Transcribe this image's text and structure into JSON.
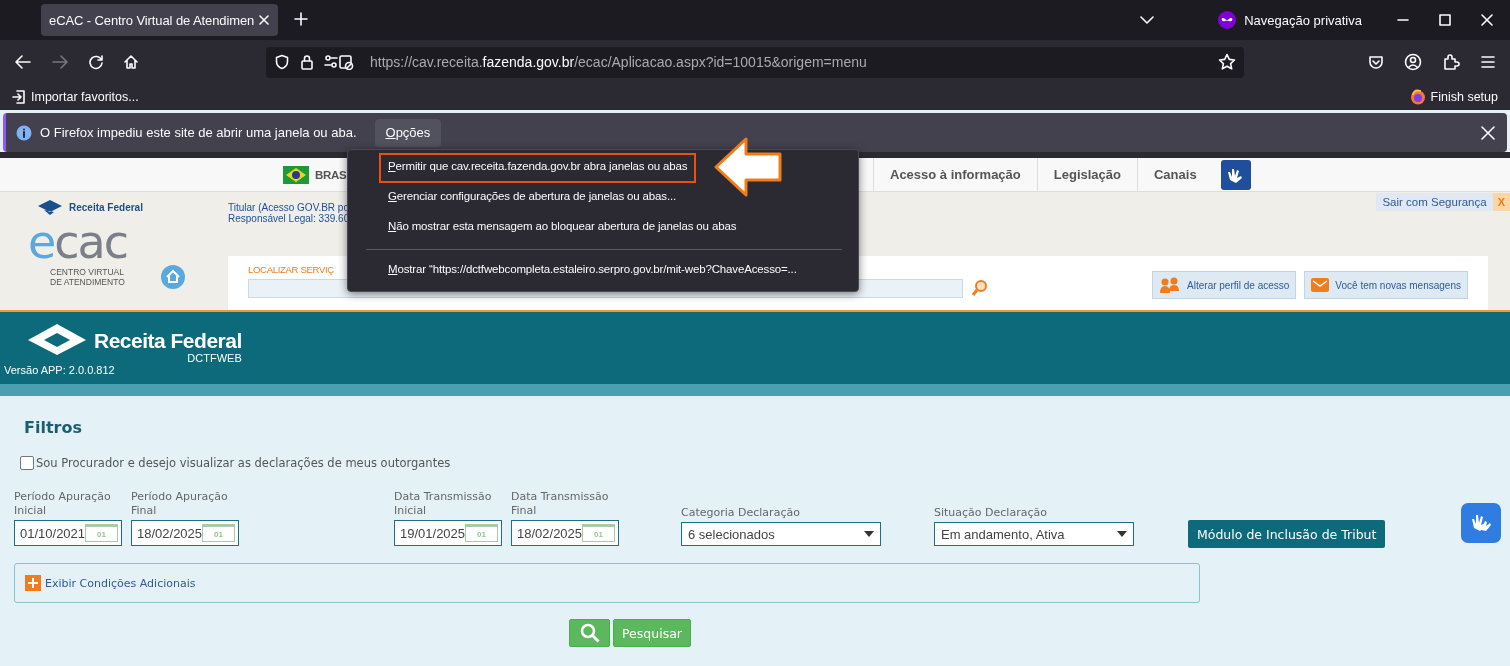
{
  "browser": {
    "tab_title": "eCAC - Centro Virtual de Atendimen",
    "private_label": "Navegação privativa",
    "url_prefix": "https://cav.receita.",
    "url_domain": "fazenda.gov.br",
    "url_suffix": "/ecac/Aplicacao.aspx?id=10015&origem=menu",
    "bookmark": "Importar favoritos...",
    "finish_setup": "Finish setup"
  },
  "notification": {
    "message": "O Firefox impediu este site de abrir uma janela ou aba.",
    "options_button": "Opções"
  },
  "popup_menu": {
    "items": [
      {
        "kind": "item",
        "label": "Permitir que cav.receita.fazenda.gov.br abra janelas ou abas",
        "highlighted": true
      },
      {
        "kind": "item",
        "label": "Gerenciar configurações de abertura de janelas ou abas...",
        "highlighted": false
      },
      {
        "kind": "item",
        "label": "Não mostrar esta mensagem ao bloquear abertura de janelas ou abas",
        "highlighted": false
      },
      {
        "kind": "separator"
      },
      {
        "kind": "item",
        "label": "Mostrar “https://dctfwebcompleta.estaleiro.serpro.gov.br/mit-web?ChaveAcesso=...",
        "highlighted": false
      }
    ]
  },
  "gov_bar": {
    "country": "BRAS",
    "links": [
      "Acesso à informação",
      "Legislação",
      "Canais"
    ]
  },
  "ecac_header": {
    "brand": "Receita Federal",
    "logo_word": "ecac",
    "logo_subtitle": "CENTRO VIRTUAL DE ATENDIMENTO",
    "user_lines": [
      "Titular (Acesso GOV.BR po",
      "Responsável Legal: 339.60"
    ],
    "logout": "Sair com Segurança",
    "logout_close": "X",
    "search_label": "LOCALIZAR SERVIÇ",
    "buttons": [
      "Alterar perfil de acesso",
      "Você tem novas mensagens"
    ]
  },
  "app_header": {
    "brand": "Receita Federal",
    "product": "DCTFWEB",
    "version": "Versão APP: 2.0.0.812"
  },
  "filters": {
    "title": "Filtros",
    "procurador": {
      "label": "Sou Procurador e desejo visualizar as declarações de meus outorgantes",
      "checked": false
    },
    "date_fields": [
      {
        "label": "Período Apuração Inicial",
        "value": "01/10/2021",
        "icon_text": "01"
      },
      {
        "label": "Período Apuração Final",
        "value": "18/02/2025",
        "icon_text": "01"
      },
      {
        "label": "Data Transmissão Inicial",
        "value": "19/01/2025",
        "icon_text": "01"
      },
      {
        "label": "Data Transmissão Final",
        "value": "18/02/2025",
        "icon_text": "01"
      }
    ],
    "selects": [
      {
        "label": "Categoria Declaração",
        "value": "6 selecionados"
      },
      {
        "label": "Situação Declaração",
        "value": "Em andamento, Ativa"
      }
    ],
    "module_button": "Módulo de Inclusão de Tribut",
    "expand_link": "Exibir Condições Adicionais",
    "search_button": "Pesquisar"
  }
}
